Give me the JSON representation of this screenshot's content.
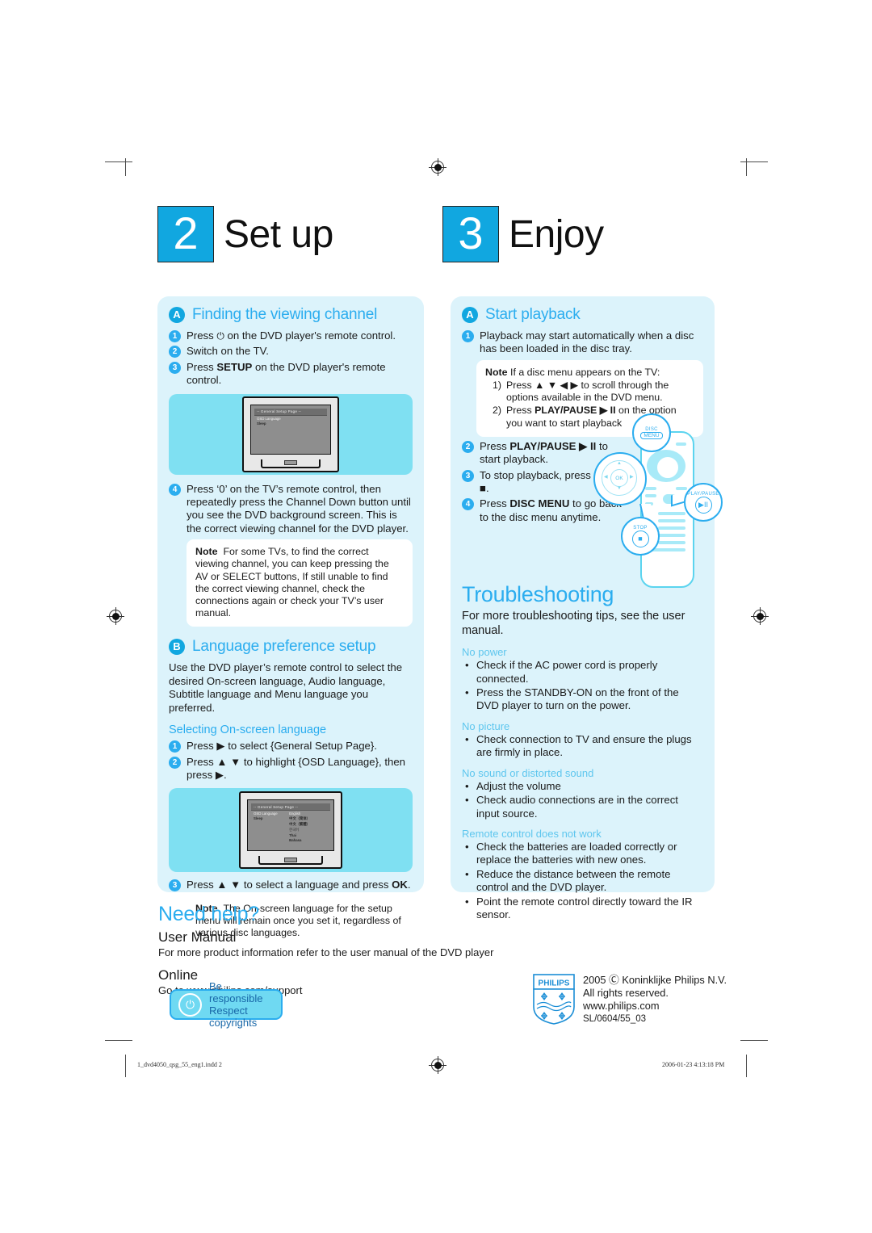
{
  "steps": [
    {
      "num": "2",
      "title": "Set up"
    },
    {
      "num": "3",
      "title": "Enjoy"
    }
  ],
  "setup": {
    "section_a": {
      "badge": "A",
      "title": "Finding the viewing channel",
      "steps": [
        {
          "num": "1",
          "text_pre": "Press ",
          "icon": "power-icon",
          "text_post": " on the DVD player's remote control."
        },
        {
          "num": "2",
          "text": "Switch on the TV."
        },
        {
          "num": "3",
          "text_pre": "Press ",
          "bold": "SETUP",
          "text_post": " on the DVD player's remote control."
        }
      ],
      "step4": {
        "num": "4",
        "text": "Press ‘0’ on the TV’s remote control, then repeatedly press the Channel Down button until you see the DVD background screen. This is the correct viewing channel for the DVD player."
      },
      "note": {
        "label": "Note",
        "text": "For some TVs, to find the correct viewing channel, you can keep pressing the AV or SELECT buttons, If still unable to find the correct viewing channel, check the connections again or check your TV’s user manual."
      }
    },
    "section_b": {
      "badge": "B",
      "title": "Language preference setup",
      "intro": "Use the DVD player’s remote control to select the desired On-screen language, Audio language, Subtitle language and Menu language you preferred.",
      "subhead": "Selecting On-screen language",
      "steps": [
        {
          "num": "1",
          "text_pre": "Press ",
          "arrows": "▶",
          "text_post": " to select {General Setup Page}."
        },
        {
          "num": "2",
          "text_pre": "Press ",
          "arrows": "▲ ▼",
          "text_post": " to highlight {OSD Language}, then press ▶."
        },
        {
          "num": "3",
          "text_pre": "Press ",
          "arrows": "▲ ▼",
          "text_post": " to select a language and press ",
          "bold": "OK",
          "tail": "."
        }
      ],
      "note": {
        "label": "Note",
        "text": "The On-screen language for the setup menu will remain once you set it, regardless of various disc languages."
      }
    }
  },
  "tv_osd": {
    "title": "-- General Setup Page --",
    "rows_screen1": [
      {
        "left": "OSD Language",
        "right": ""
      },
      {
        "left": "Sleep",
        "right": ""
      }
    ],
    "rows_screen2": [
      {
        "left": "OSD Language",
        "right": "English"
      },
      {
        "left": "Sleep",
        "right": "中文（简体）"
      },
      {
        "left": "",
        "right": "中文（繁體）"
      },
      {
        "left": "",
        "right": "한국어"
      },
      {
        "left": "",
        "right": "Thai"
      },
      {
        "left": "",
        "right": "Bahasa"
      }
    ]
  },
  "enjoy": {
    "section_a": {
      "badge": "A",
      "title": "Start playback",
      "step1": {
        "num": "1",
        "text": "Playback may start automatically when a disc has been loaded in the disc tray."
      },
      "note": {
        "label": "Note",
        "intro": "If a disc menu appears on the TV:",
        "items": [
          {
            "num": "1)",
            "text_pre": "Press ",
            "arrows": "▲ ▼ ◀ ▶",
            "text_post": " to scroll through the options available in the DVD menu."
          },
          {
            "num": "2)",
            "text_pre": "Press ",
            "bold": "PLAY/PAUSE",
            "arrows": "▶ II",
            "text_post": " on the option you want to start playback"
          }
        ]
      },
      "steps": [
        {
          "num": "2",
          "text_pre": "Press ",
          "bold": "PLAY/PAUSE",
          "arrows": "▶ II",
          "text_post": " to start playback."
        },
        {
          "num": "3",
          "text_pre": "To stop playback, press ",
          "bold": "STOP",
          "arrows": "■",
          "text_post": "."
        },
        {
          "num": "4",
          "text_pre": "Press ",
          "bold": "DISC MENU",
          "text_post": " to go back to the disc menu anytime."
        }
      ]
    },
    "remote": {
      "callout_disc": {
        "line1": "DISC",
        "line2": "MENU"
      },
      "callout_play": {
        "label": "PLAY/PAUSE",
        "glyph": "▶II"
      },
      "callout_stop": {
        "label": "STOP",
        "glyph": "■"
      },
      "nav_ok": "OK"
    }
  },
  "troubleshooting": {
    "title": "Troubleshooting",
    "intro": "For more troubleshooting tips, see the user manual.",
    "groups": [
      {
        "title": "No power",
        "items": [
          "Check if the AC power cord is properly connected.",
          "Press the STANDBY-ON on the front of the DVD player to turn on the power."
        ]
      },
      {
        "title": "No picture",
        "items": [
          "Check connection to TV and ensure the plugs are firmly in place."
        ]
      },
      {
        "title": "No sound or distorted sound",
        "items": [
          "Adjust the volume",
          "Check audio connections are in the correct input source."
        ]
      },
      {
        "title": "Remote control does not work",
        "items": [
          "Check the batteries are loaded correctly or replace the batteries with new ones.",
          "Reduce the distance between the remote control and the DVD player.",
          "Point the remote control directly toward the IR sensor."
        ]
      }
    ],
    "bullet": "•"
  },
  "need_help": {
    "title": "Need help?",
    "manual_head": "User Manual",
    "manual_text": "For more product information refer to the user manual of the DVD player",
    "online_head": "Online",
    "online_text": "Go to www.philips.com/support"
  },
  "responsible": {
    "line1": "Be responsible",
    "line2": "Respect copyrights",
    "icon": "power-circle-icon"
  },
  "philips": {
    "wordmark": "PHILIPS",
    "line1": "2005 Ⓒ Koninklijke Philips N.V.",
    "line2": "All rights reserved.",
    "line3": "www.philips.com",
    "line4": "SL/0604/55_03"
  },
  "print_footer": {
    "filename": "1_dvd4050_qsg_55_eng1.indd   2",
    "timestamp": "2006-01-23   4:13:18 PM"
  },
  "colors": {
    "accent": "#2badef",
    "accent_dark": "#11a7e0",
    "panel_bg": "#dcf3fb",
    "tv_bg": "#7fe0f2",
    "group_head": "#5ec6ee"
  }
}
